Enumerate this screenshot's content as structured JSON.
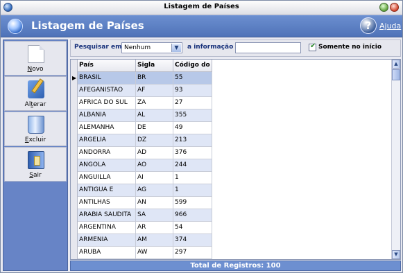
{
  "window": {
    "title": "Listagem de Países"
  },
  "header": {
    "title": "Listagem de Países",
    "help_label": "Ajuda",
    "help_glyph": "?"
  },
  "toolbar": {
    "buttons": [
      {
        "prefix": "",
        "underlined": "N",
        "suffix": "ovo",
        "icon": "new-document-icon"
      },
      {
        "prefix": "Al",
        "underlined": "t",
        "suffix": "erar",
        "icon": "edit-pencil-icon"
      },
      {
        "prefix": "",
        "underlined": "E",
        "suffix": "xcluir",
        "icon": "trash-icon"
      },
      {
        "prefix": "",
        "underlined": "S",
        "suffix": "air",
        "icon": "exit-door-icon"
      }
    ]
  },
  "search": {
    "search_label": "Pesquisar em",
    "field_value": "Nenhum",
    "info_label": "a informação",
    "info_value": "",
    "only_start_label": "Somente no início",
    "only_start_checked": true
  },
  "grid": {
    "columns": [
      "País",
      "Sigla",
      "Código do"
    ],
    "rows": [
      [
        "BRASIL",
        "BR",
        "55"
      ],
      [
        "AFEGANISTAO",
        "AF",
        "93"
      ],
      [
        "AFRICA DO SUL",
        "ZA",
        "27"
      ],
      [
        "ALBANIA",
        "AL",
        "355"
      ],
      [
        "ALEMANHA",
        "DE",
        "49"
      ],
      [
        "ARGELIA",
        "DZ",
        "213"
      ],
      [
        "ANDORRA",
        "AD",
        "376"
      ],
      [
        "ANGOLA",
        "AO",
        "244"
      ],
      [
        "ANGUILLA",
        "AI",
        "1"
      ],
      [
        "ANTIGUA E",
        "AG",
        "1"
      ],
      [
        "ANTILHAS",
        "AN",
        "599"
      ],
      [
        "ARABIA SAUDITA",
        "SA",
        "966"
      ],
      [
        "ARGENTINA",
        "AR",
        "54"
      ],
      [
        "ARMENIA",
        "AM",
        "374"
      ],
      [
        "ARUBA",
        "AW",
        "297"
      ]
    ],
    "selected_row": 0
  },
  "status": {
    "total_label": "Total de Registros: 100"
  }
}
